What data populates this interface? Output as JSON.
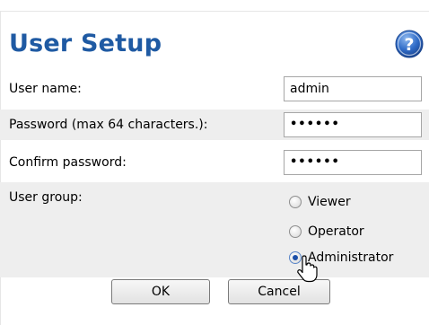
{
  "dialog": {
    "title": "User Setup",
    "help_icon": "question-mark-icon"
  },
  "fields": {
    "username": {
      "label": "User name:",
      "value": "admin"
    },
    "password": {
      "label": "Password (max 64 characters.):",
      "value": "••••••"
    },
    "confirm": {
      "label": "Confirm password:",
      "value": "••••••"
    }
  },
  "user_group": {
    "label": "User group:",
    "options": [
      "Viewer",
      "Operator",
      "Administrator"
    ],
    "selected": "Administrator"
  },
  "buttons": {
    "ok": "OK",
    "cancel": "Cancel"
  },
  "colors": {
    "title": "#1f5aa3",
    "row_alt": "#eeeeee",
    "help_icon": "#2f6bc7"
  }
}
